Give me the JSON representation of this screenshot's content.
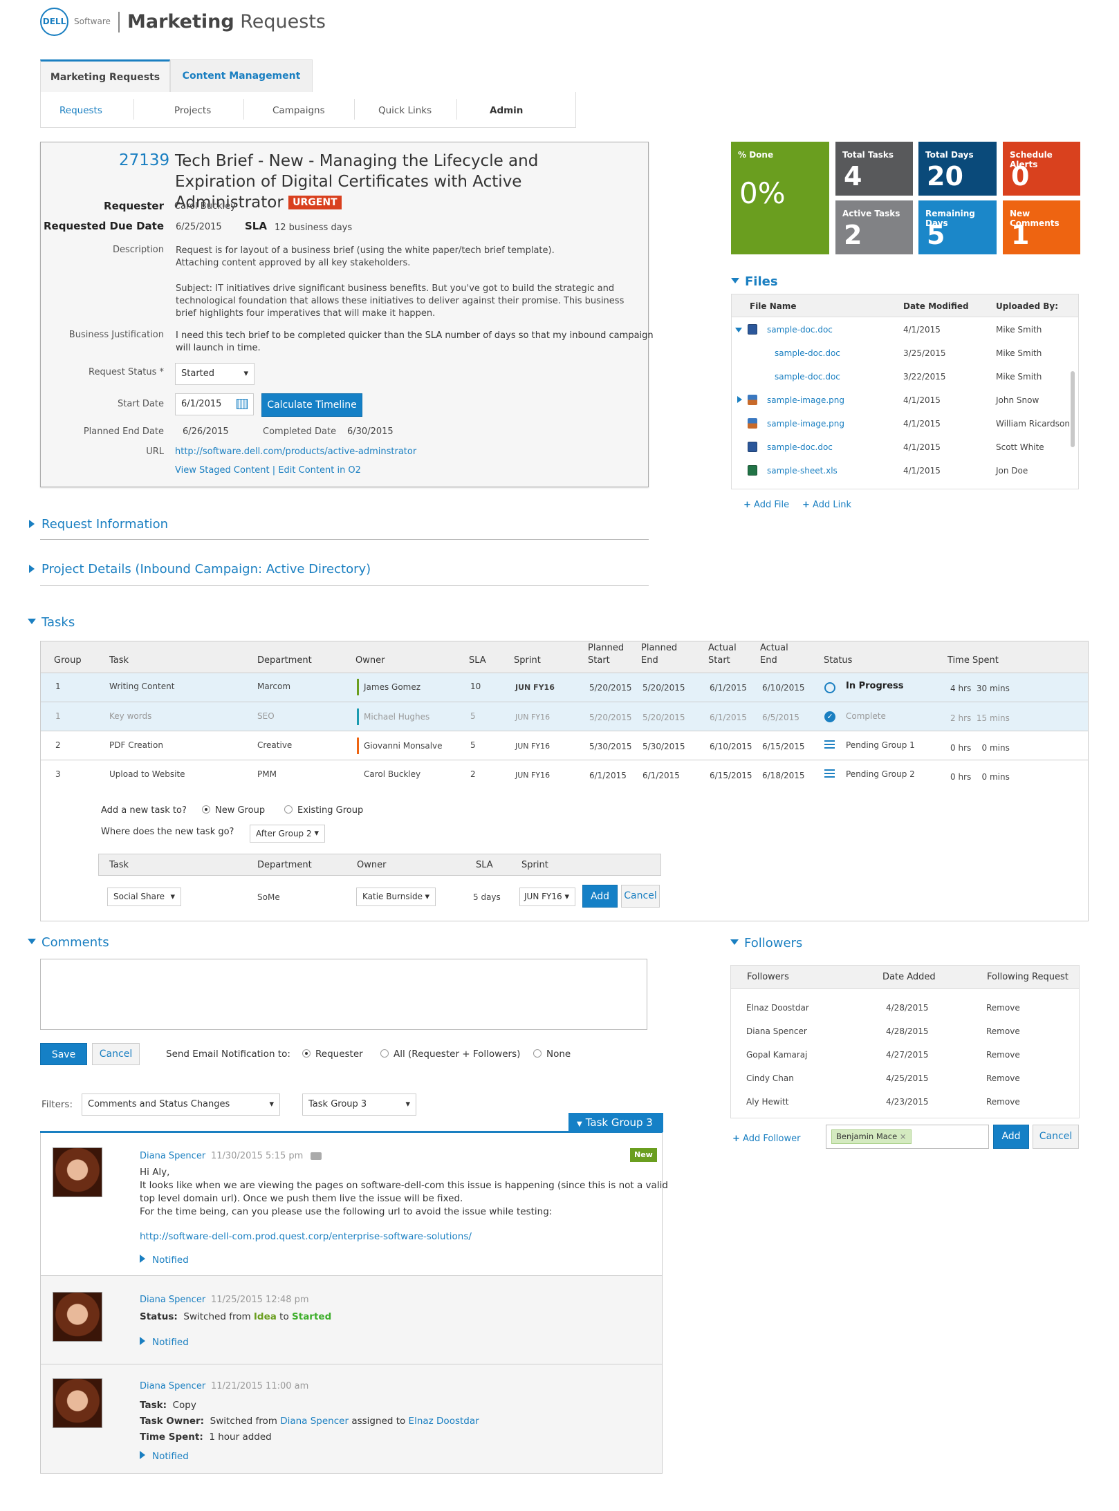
{
  "header": {
    "logo": "DELL",
    "brand": "Software",
    "title_bold": "Marketing",
    "title_rest": " Requests"
  },
  "tabs": [
    {
      "label": "Marketing Requests"
    },
    {
      "label": "Content Management"
    }
  ],
  "subnav": [
    {
      "label": "Requests"
    },
    {
      "label": "Projects"
    },
    {
      "label": "Campaigns"
    },
    {
      "label": "Quick Links"
    },
    {
      "label": "Admin"
    }
  ],
  "request": {
    "id": "27139",
    "title": "Tech Brief - New - Managing the Lifecycle and Expiration of Digital Certificates with Active Administrator",
    "badge": "URGENT",
    "requester_label": "Requester",
    "requester": "Carol Buckley",
    "due_label": "Requested Due Date",
    "due": "6/25/2015",
    "sla_label": "SLA",
    "sla": "12 business days",
    "description_label": "Description",
    "description_1": "Request is for layout of a business brief (using the white paper/tech brief template).",
    "description_2": "Attaching content approved by all key stakeholders.",
    "description_3": "Subject: IT initiatives drive significant business benefits. But you've got to build the strategic and",
    "description_4": "technological foundation that allows these initiatives to deliver against their promise. This business",
    "description_5": "brief highlights four imperatives that will make it happen.",
    "justification_label": "Business Justification",
    "justification_1": "I need this tech brief to be completed quicker than the SLA number of days so that my inbound campaign",
    "justification_2": "will launch in time.",
    "status_label": "Request Status *",
    "status": "Started",
    "start_label": "Start Date",
    "start": "6/1/2015",
    "calc_button": "Calculate Timeline",
    "planned_end_label": "Planned End Date",
    "planned_end": "6/26/2015",
    "completed_label": "Completed Date",
    "completed": "6/30/2015",
    "url_label": "URL",
    "url": "http://software.dell.com/products/active-adminstrator",
    "link_staged": "View Staged Content",
    "link_sep": "|",
    "link_edit": "Edit Content in O2"
  },
  "stats": {
    "done_label": "% Done",
    "done": "0%",
    "total_tasks_label": "Total Tasks",
    "total_tasks": "4",
    "total_days_label": "Total Days",
    "total_days": "20",
    "alerts_label": "Schedule Alerts",
    "alerts": "0",
    "active_tasks_label": "Active Tasks",
    "active_tasks": "2",
    "remaining_label": "Remaining Days",
    "remaining": "5",
    "comments_label": "New Comments",
    "comments": "1",
    "colors": {
      "green": "#6a9e1f",
      "gray": "#58595b",
      "navy": "#0a4a7a",
      "red": "#d9411e",
      "mid": "#818285",
      "blue": "#1b87c9",
      "orange": "#ee6411"
    }
  },
  "files": {
    "title": "Files",
    "headers": [
      "File Name",
      "Date Modified",
      "Uploaded By:"
    ],
    "rows": [
      {
        "name": "sample-doc.doc",
        "date": "4/1/2015",
        "by": "Mike Smith"
      },
      {
        "name": "sample-doc.doc",
        "date": "3/25/2015",
        "by": "Mike Smith"
      },
      {
        "name": "sample-doc.doc",
        "date": "3/22/2015",
        "by": "Mike Smith"
      },
      {
        "name": "sample-image.png",
        "date": "4/1/2015",
        "by": "John Snow"
      },
      {
        "name": "sample-image.png",
        "date": "4/1/2015",
        "by": "William Ricardson"
      },
      {
        "name": "sample-doc.doc",
        "date": "4/1/2015",
        "by": "Scott White"
      },
      {
        "name": "sample-sheet.xls",
        "date": "4/1/2015",
        "by": "Jon Doe"
      }
    ],
    "add_file": "Add File",
    "add_link": "Add Link"
  },
  "sections": {
    "request_info": "Request Information",
    "project_details": "Project Details (Inbound Campaign: Active Directory)",
    "tasks": "Tasks",
    "comments": "Comments",
    "followers": "Followers"
  },
  "tasks": {
    "headers": {
      "group": "Group",
      "task": "Task",
      "dept": "Department",
      "owner": "Owner",
      "sla": "SLA",
      "sprint": "Sprint",
      "ps1": "Planned",
      "ps2": "Start",
      "pe1": "Planned",
      "pe2": "End",
      "as1": "Actual",
      "as2": "Start",
      "ae1": "Actual",
      "ae2": "End",
      "status": "Status",
      "time": "Time Spent"
    },
    "rows": [
      {
        "group": "1",
        "task": "Writing Content",
        "dept": "Marcom",
        "owner": "James Gomez",
        "sla": "10",
        "sprint": "JUN FY16",
        "ps": "5/20/2015",
        "pe": "5/20/2015",
        "as": "6/1/2015",
        "ae": "6/10/2015",
        "status": "In Progress",
        "h": "4 hrs",
        "m": "30 mins"
      },
      {
        "group": "1",
        "task": "Key words",
        "dept": "SEO",
        "owner": "Michael Hughes",
        "sla": "5",
        "sprint": "JUN FY16",
        "ps": "5/20/2015",
        "pe": "5/20/2015",
        "as": "6/1/2015",
        "ae": "6/5/2015",
        "status": "Complete",
        "h": "2 hrs",
        "m": "15 mins"
      },
      {
        "group": "2",
        "task": "PDF Creation",
        "dept": "Creative",
        "owner": "Giovanni Monsalve",
        "sla": "5",
        "sprint": "JUN FY16",
        "ps": "5/30/2015",
        "pe": "5/30/2015",
        "as": "6/10/2015",
        "ae": "6/15/2015",
        "status": "Pending Group 1",
        "h": "0 hrs",
        "m": "0 mins"
      },
      {
        "group": "3",
        "task": "Upload to Website",
        "dept": "PMM",
        "owner": "Carol Buckley",
        "sla": "2",
        "sprint": "JUN FY16",
        "ps": "6/1/2015",
        "pe": "6/1/2015",
        "as": "6/15/2015",
        "ae": "6/18/2015",
        "status": "Pending Group 2",
        "h": "0 hrs",
        "m": "0 mins"
      }
    ],
    "owner_colors": [
      "#6a9e1f",
      "#1b9bb0",
      "#ee6411",
      "transparent"
    ],
    "add_q": "Add a new task to?",
    "opt_new": "New Group",
    "opt_existing": "Existing Group",
    "where_q": "Where does the new task go?",
    "where_val": "After Group 2",
    "new_headers": {
      "task": "Task",
      "dept": "Department",
      "owner": "Owner",
      "sla": "SLA",
      "sprint": "Sprint"
    },
    "new_task": "Social Share",
    "new_dept": "SoMe",
    "new_owner": "Katie Burnside",
    "new_sla": "5 days",
    "new_sprint": "JUN FY16",
    "add_btn": "Add",
    "cancel_btn": "Cancel"
  },
  "comments": {
    "save": "Save",
    "cancel": "Cancel",
    "notify_label": "Send Email Notification to:",
    "opt_requester": "Requester",
    "opt_all": "All (Requester + Followers)",
    "opt_none": "None",
    "filters_label": "Filters:",
    "filter1": "Comments and Status Changes",
    "filter2": "Task Group 3",
    "group_tag": "Task Group 3",
    "items": [
      {
        "name": "Diana Spencer",
        "date": "11/30/2015  5:15 pm",
        "badge": "New",
        "l1": "Hi Aly,",
        "l2": "It looks like when we are viewing the pages on software-dell-com this issue is happening (since this is not a valid",
        "l3": "top level domain url). Once we push them live the issue will be fixed.",
        "l4": "For the time being, can you please use the following url to avoid the issue while testing:",
        "link": "http://software-dell-com.prod.quest.corp/enterprise-software-solutions/",
        "notified": "Notified"
      },
      {
        "name": "Diana Spencer",
        "date": "11/25/2015  12:48 pm",
        "status_label": "Status:",
        "status_pre": "Switched from",
        "from": "Idea",
        "to_word": "to",
        "to": "Started",
        "notified": "Notified"
      },
      {
        "name": "Diana Spencer",
        "date": "11/21/2015  11:00 am",
        "task_label": "Task:",
        "task": "Copy",
        "owner_label": "Task Owner:",
        "owner_pre": "Switched from",
        "owner_from": "Diana Spencer",
        "owner_mid": "assigned to",
        "owner_to": "Elnaz Doostdar",
        "time_label": "Time Spent:",
        "time": "1 hour added",
        "notified": "Notified"
      }
    ]
  },
  "followers": {
    "headers": [
      "Followers",
      "Date Added",
      "Following Request"
    ],
    "rows": [
      {
        "name": "Elnaz Doostdar",
        "date": "4/28/2015",
        "action": "Remove"
      },
      {
        "name": "Diana Spencer",
        "date": "4/28/2015",
        "action": "Remove"
      },
      {
        "name": "Gopal Kamaraj",
        "date": "4/27/2015",
        "action": "Remove"
      },
      {
        "name": "Cindy Chan",
        "date": "4/25/2015",
        "action": "Remove"
      },
      {
        "name": "Aly Hewitt",
        "date": "4/23/2015",
        "action": "Remove"
      }
    ],
    "add_follower": "Add Follower",
    "chip": "Benjamin Mace",
    "add": "Add",
    "cancel": "Cancel"
  }
}
